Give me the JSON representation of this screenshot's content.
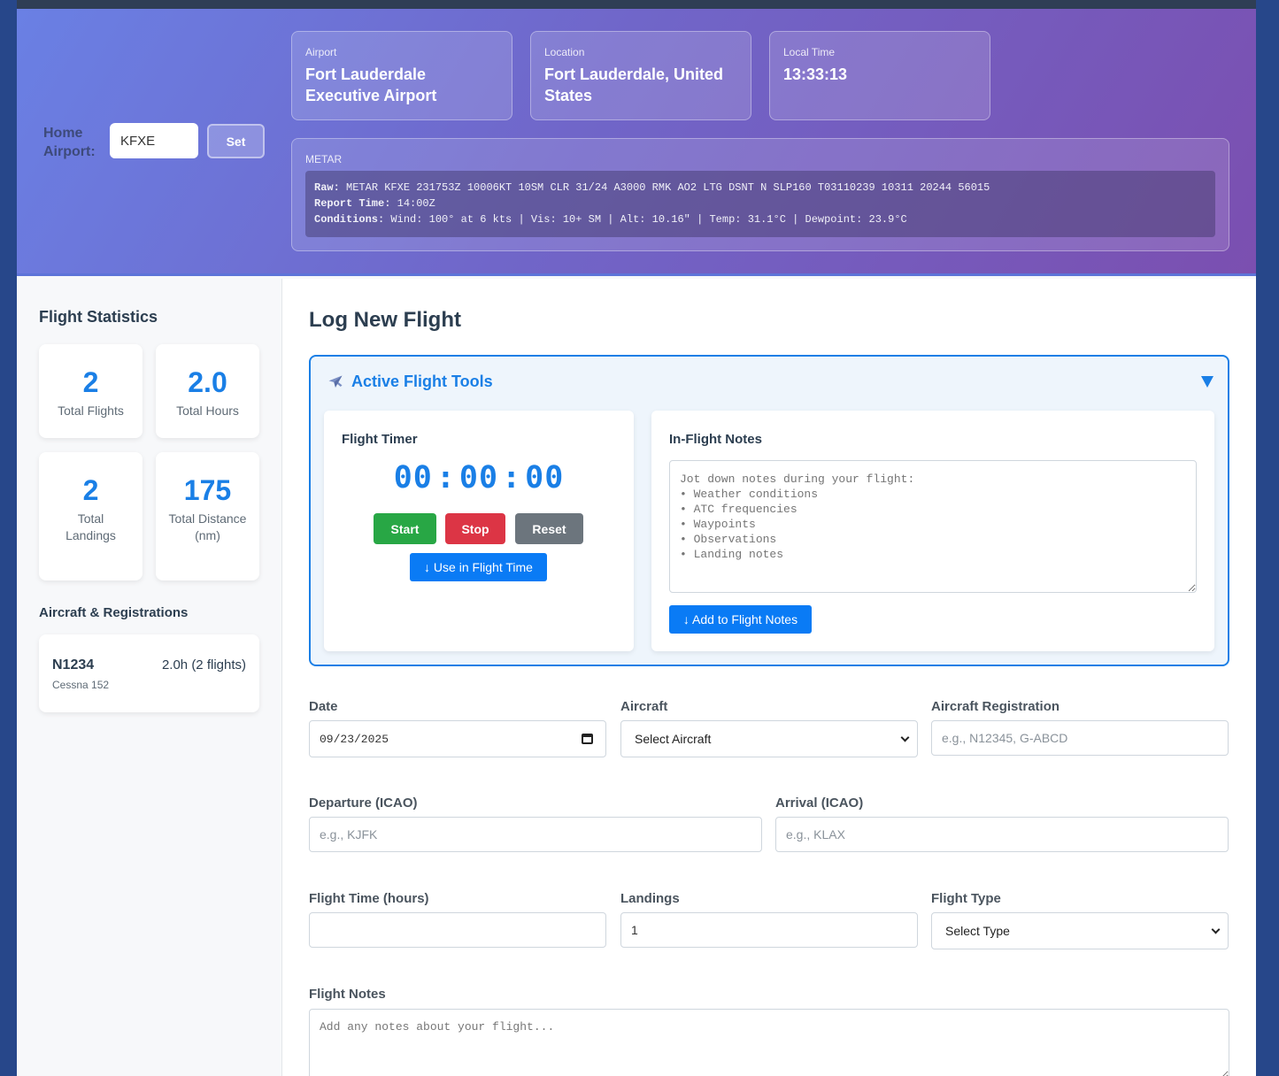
{
  "header": {
    "home_airport_label": "Home Airport:",
    "home_airport_value": "KFXE",
    "set_button": "Set",
    "airport": {
      "label": "Airport",
      "value": "Fort Lauderdale Executive Airport"
    },
    "location": {
      "label": "Location",
      "value": "Fort Lauderdale, United States"
    },
    "local_time": {
      "label": "Local Time",
      "value": "13:33:13"
    },
    "metar": {
      "label": "METAR",
      "raw_label": "Raw:",
      "raw": "METAR KFXE 231753Z 10006KT 10SM CLR 31/24 A3000 RMK AO2 LTG DSNT N SLP160 T03110239 10311 20244 56015",
      "report_time_label": "Report Time:",
      "report_time": "14:00Z",
      "conditions_label": "Conditions:",
      "conditions": "Wind: 100° at 6 kts | Vis: 10+ SM | Alt: 10.16\" | Temp: 31.1°C | Dewpoint: 23.9°C"
    }
  },
  "sidebar": {
    "stats_title": "Flight Statistics",
    "stats": [
      {
        "value": "2",
        "label": "Total Flights"
      },
      {
        "value": "2.0",
        "label": "Total Hours"
      },
      {
        "value": "2",
        "label": "Total Landings"
      },
      {
        "value": "175",
        "label": "Total Distance (nm)"
      }
    ],
    "aircraft_title": "Aircraft & Registrations",
    "aircraft": [
      {
        "registration": "N1234",
        "type": "Cessna 152",
        "summary": "2.0h (2 flights)"
      }
    ]
  },
  "main": {
    "title": "Log New Flight",
    "tools": {
      "title": "Active Flight Tools",
      "timer": {
        "title": "Flight Timer",
        "display": "00:00:00",
        "start": "Start",
        "stop": "Stop",
        "reset": "Reset",
        "use_button": "↓ Use in Flight Time"
      },
      "notes": {
        "title": "In-Flight Notes",
        "placeholder": "Jot down notes during your flight:\n• Weather conditions\n• ATC frequencies\n• Waypoints\n• Observations\n• Landing notes",
        "add_button": "↓ Add to Flight Notes"
      }
    },
    "form": {
      "date_label": "Date",
      "date_value": "09/23/2025",
      "aircraft_label": "Aircraft",
      "aircraft_selected": "Select Aircraft",
      "registration_label": "Aircraft Registration",
      "registration_placeholder": "e.g., N12345, G-ABCD",
      "departure_label": "Departure (ICAO)",
      "departure_placeholder": "e.g., KJFK",
      "arrival_label": "Arrival (ICAO)",
      "arrival_placeholder": "e.g., KLAX",
      "flight_time_label": "Flight Time (hours)",
      "flight_time_value": "",
      "landings_label": "Landings",
      "landings_value": "1",
      "flight_type_label": "Flight Type",
      "flight_type_selected": "Select Type",
      "notes_label": "Flight Notes",
      "notes_placeholder": "Add any notes about your flight..."
    }
  },
  "colors": {
    "accent": "#1a7fe6",
    "start": "#28a745",
    "stop": "#dc3545",
    "reset": "#6c757d"
  },
  "icons": {
    "tools": "airplane-icon",
    "collapse": "triangle-down-icon",
    "date": "calendar-icon",
    "select": "chevron-down-icon"
  }
}
